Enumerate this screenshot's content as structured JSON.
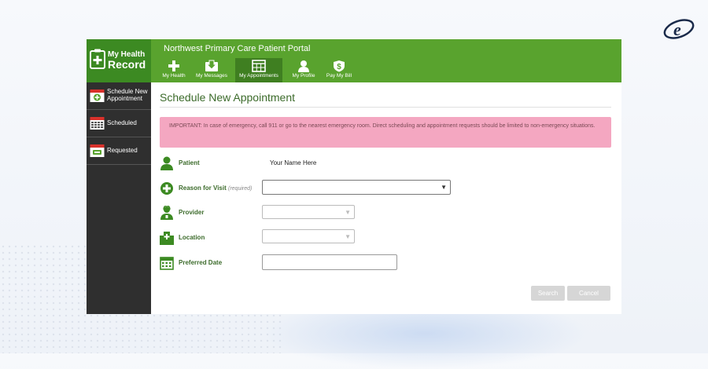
{
  "portal": {
    "title": "Northwest Primary Care Patient Portal"
  },
  "logo": {
    "line1": "My Health",
    "line2": "Record"
  },
  "nav": {
    "items": [
      {
        "label": "My Health",
        "icon": "plus-icon"
      },
      {
        "label": "My Messages",
        "icon": "inbox-icon"
      },
      {
        "label": "My Appointments",
        "icon": "calendar-grid-icon",
        "active": true
      },
      {
        "label": "My Profile",
        "icon": "person-icon"
      },
      {
        "label": "Pay My Bill",
        "icon": "dollar-shield-icon"
      }
    ]
  },
  "sidebar": {
    "items": [
      {
        "label_line1": "Schedule New",
        "label_line2": "Appointment",
        "icon": "calendar-plus-icon"
      },
      {
        "label_line1": "Scheduled",
        "label_line2": "",
        "icon": "calendar-grid-icon"
      },
      {
        "label_line1": "Requested",
        "label_line2": "",
        "icon": "calendar-request-icon"
      }
    ]
  },
  "page": {
    "title": "Schedule New Appointment",
    "alert": "IMPORTANT: In case of emergency, call 911 or go to the nearest emergency room. Direct scheduling and appointment requests should be limited to non-emergency situations."
  },
  "form": {
    "patient": {
      "label": "Patient",
      "value": "Your Name Here"
    },
    "reason": {
      "label": "Reason for Visit",
      "required": "(required)",
      "value": ""
    },
    "provider": {
      "label": "Provider",
      "value": ""
    },
    "location": {
      "label": "Location",
      "value": ""
    },
    "preferred_date": {
      "label": "Preferred Date",
      "value": ""
    }
  },
  "buttons": {
    "search": "Search",
    "cancel": "Cancel"
  },
  "colors": {
    "brand_green": "#59a32e",
    "dark_green": "#3c8a22",
    "sidebar_bg": "#2f2f2f",
    "alert_bg": "#f4a7c1",
    "label_green": "#3c6b2b"
  }
}
